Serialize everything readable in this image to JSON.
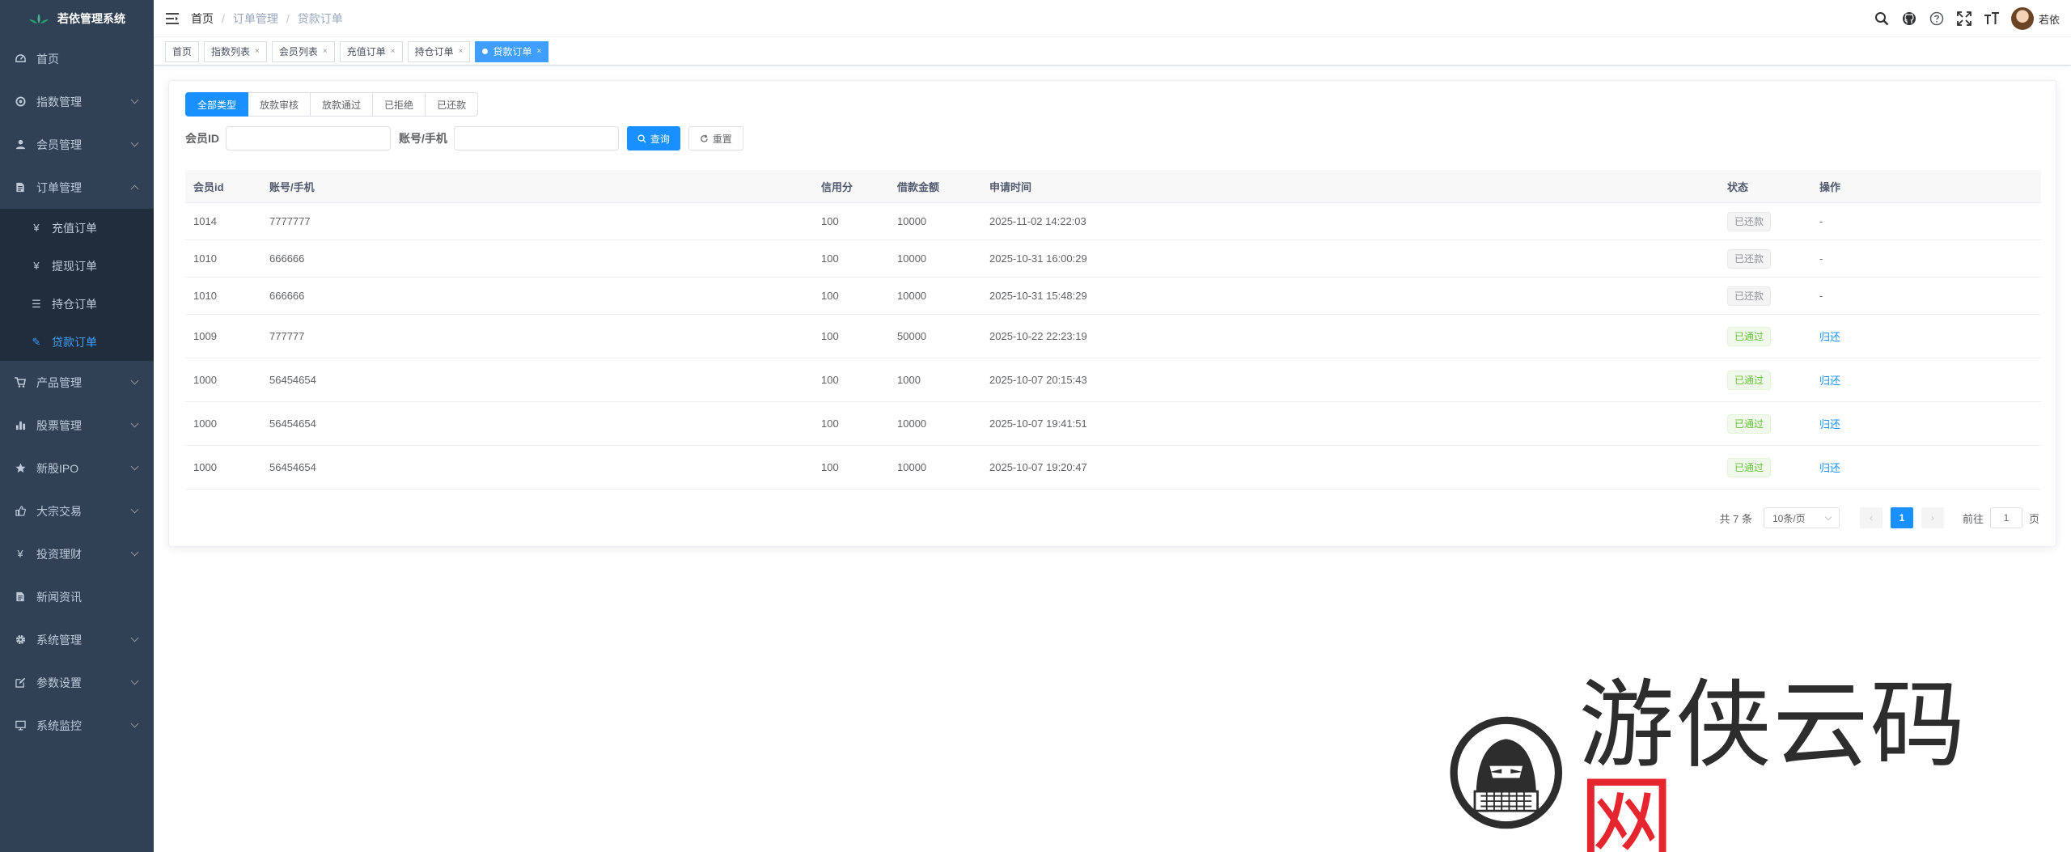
{
  "sidebar": {
    "title": "若依管理系统",
    "items": [
      {
        "label": "首页",
        "icon": "dashboard-icon"
      },
      {
        "label": "指数管理",
        "icon": "target-icon"
      },
      {
        "label": "会员管理",
        "icon": "user-icon"
      },
      {
        "label": "订单管理",
        "icon": "document-icon"
      },
      {
        "label": "产品管理",
        "icon": "cart-icon"
      },
      {
        "label": "股票管理",
        "icon": "bar-chart-icon"
      },
      {
        "label": "新股IPO",
        "icon": "star-icon"
      },
      {
        "label": "大宗交易",
        "icon": "thumb-icon"
      },
      {
        "label": "投资理财",
        "icon": "yen-icon"
      },
      {
        "label": "新闻资讯",
        "icon": "news-icon"
      },
      {
        "label": "系统管理",
        "icon": "gear-icon"
      },
      {
        "label": "参数设置",
        "icon": "edit-icon"
      },
      {
        "label": "系统监控",
        "icon": "monitor-icon"
      }
    ],
    "order_sub": [
      {
        "label": "充值订单",
        "icon": "¥"
      },
      {
        "label": "提现订单",
        "icon": "¥"
      },
      {
        "label": "持仓订单",
        "icon": "☰"
      },
      {
        "label": "贷款订单",
        "icon": "✎"
      }
    ]
  },
  "navbar": {
    "breadcrumb": [
      "首页",
      "订单管理",
      "贷款订单"
    ],
    "username": "若依"
  },
  "tags": [
    "首页",
    "指数列表",
    "会员列表",
    "充值订单",
    "持仓订单",
    "贷款订单"
  ],
  "filters": {
    "status_options": [
      "全部类型",
      "放款审核",
      "放款通过",
      "已拒绝",
      "已还款"
    ],
    "member_id_label": "会员ID",
    "account_label": "账号/手机",
    "search_label": "查询",
    "reset_label": "重置"
  },
  "table": {
    "headers": [
      "会员id",
      "账号/手机",
      "信用分",
      "借款金额",
      "申请时间",
      "状态",
      "操作"
    ],
    "rows": [
      {
        "id": "1014",
        "account": "7777777",
        "credit": "100",
        "amount": "10000",
        "time": "2025-11-02 14:22:03",
        "status": "已还款",
        "status_type": "info",
        "action": "-"
      },
      {
        "id": "1010",
        "account": "666666",
        "credit": "100",
        "amount": "10000",
        "time": "2025-10-31 16:00:29",
        "status": "已还款",
        "status_type": "info",
        "action": "-"
      },
      {
        "id": "1010",
        "account": "666666",
        "credit": "100",
        "amount": "10000",
        "time": "2025-10-31 15:48:29",
        "status": "已还款",
        "status_type": "info",
        "action": "-"
      },
      {
        "id": "1009",
        "account": "777777",
        "credit": "100",
        "amount": "50000",
        "time": "2025-10-22 22:23:19",
        "status": "已通过",
        "status_type": "success",
        "action": "归还"
      },
      {
        "id": "1000",
        "account": "56454654",
        "credit": "100",
        "amount": "1000",
        "time": "2025-10-07 20:15:43",
        "status": "已通过",
        "status_type": "success",
        "action": "归还"
      },
      {
        "id": "1000",
        "account": "56454654",
        "credit": "100",
        "amount": "10000",
        "time": "2025-10-07 19:41:51",
        "status": "已通过",
        "status_type": "success",
        "action": "归还"
      },
      {
        "id": "1000",
        "account": "56454654",
        "credit": "100",
        "amount": "10000",
        "time": "2025-10-07 19:20:47",
        "status": "已通过",
        "status_type": "success",
        "action": "归还"
      }
    ]
  },
  "pagination": {
    "total_label": "共 7 条",
    "page_size": "10条/页",
    "current_page": "1",
    "goto_label": "前往",
    "goto_value": "1",
    "page_suffix": "页"
  },
  "watermark": {
    "text_main": "游侠云码",
    "text_accent": "网"
  },
  "colors": {
    "sidebar_bg": "#304156",
    "accent": "#1890ff",
    "success": "#67c23a"
  }
}
